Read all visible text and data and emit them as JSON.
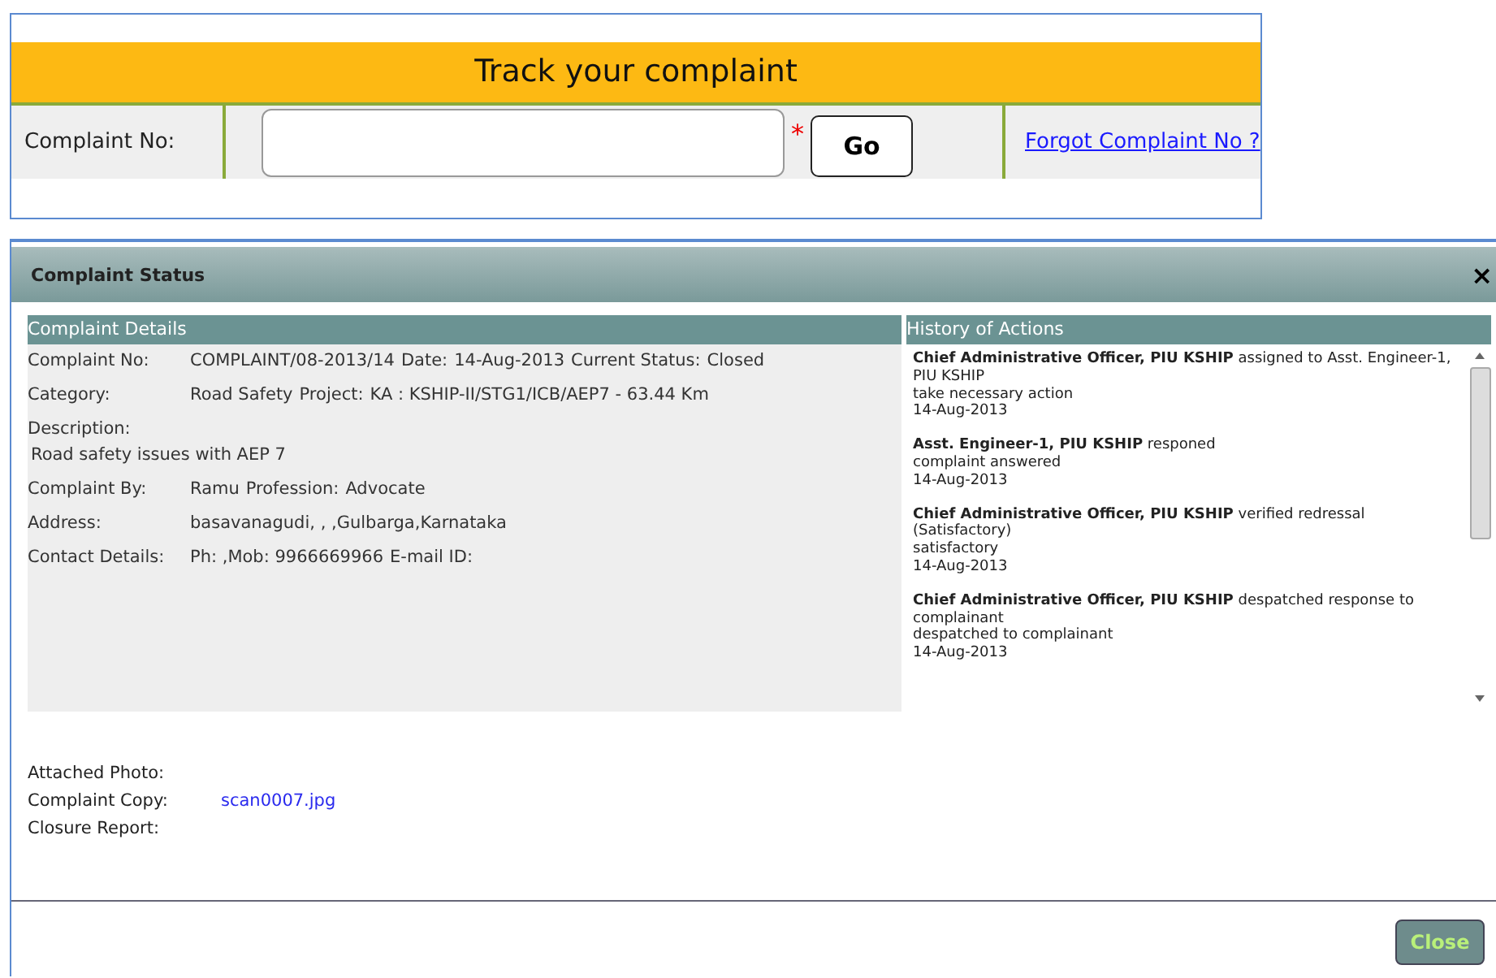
{
  "tracker": {
    "title": "Track your complaint",
    "label": "Complaint No:",
    "required_mark": "*",
    "go_button": "Go",
    "forgot_link": "Forgot Complaint No ?"
  },
  "dialog": {
    "title": "Complaint Status",
    "close_icon": "×",
    "details": {
      "heading": "Complaint Details",
      "rows": [
        {
          "kind": "pairs",
          "cells": [
            "Complaint No:",
            "COMPLAINT/08-2013/14",
            "Date:",
            "14-Aug-2013",
            "Current Status:",
            "Closed"
          ]
        },
        {
          "kind": "pairs",
          "cells": [
            "Category:",
            "Road Safety",
            "Project:",
            "KA : KSHIP-II/STG1/ICB/AEP7 - 63.44 Km"
          ]
        },
        {
          "kind": "block",
          "cells": [
            "Description:",
            "Road safety issues with AEP 7"
          ]
        },
        {
          "kind": "pairs",
          "cells": [
            "Complaint By:",
            "Ramu",
            "Profession:",
            "Advocate"
          ]
        },
        {
          "kind": "pairs",
          "cells": [
            "Address:",
            "basavanagudi, , ,Gulbarga,Karnataka"
          ]
        },
        {
          "kind": "pairs",
          "cells": [
            "Contact Details:",
            "Ph: ,Mob: 9966669966",
            "E-mail ID:"
          ]
        }
      ]
    },
    "history": {
      "heading": "History of Actions",
      "entries": [
        {
          "text": "**Chief Administrative Officer, PIU KSHIP** assigned to Asst. Engineer-1, PIU KSHIP",
          "lines": [
            "take necessary action",
            "14-Aug-2013"
          ]
        },
        {
          "text": "**Asst. Engineer-1, PIU KSHIP** responed",
          "lines": [
            "complaint answered",
            "14-Aug-2013"
          ]
        },
        {
          "text": "**Chief Administrative Officer, PIU KSHIP** verified redressal (Satisfactory)",
          "lines": [
            "satisfactory",
            "14-Aug-2013"
          ]
        },
        {
          "text": "**Chief Administrative Officer, PIU KSHIP** despatched response to complainant",
          "lines": [
            "despatched to complainant",
            "14-Aug-2013"
          ]
        }
      ]
    },
    "attachments": [
      {
        "label": "Attached Photo:"
      },
      {
        "label": "Complaint Copy:",
        "link": "scan0007.jpg"
      },
      {
        "label": "Closure Report:"
      }
    ],
    "close_button": "Close"
  }
}
